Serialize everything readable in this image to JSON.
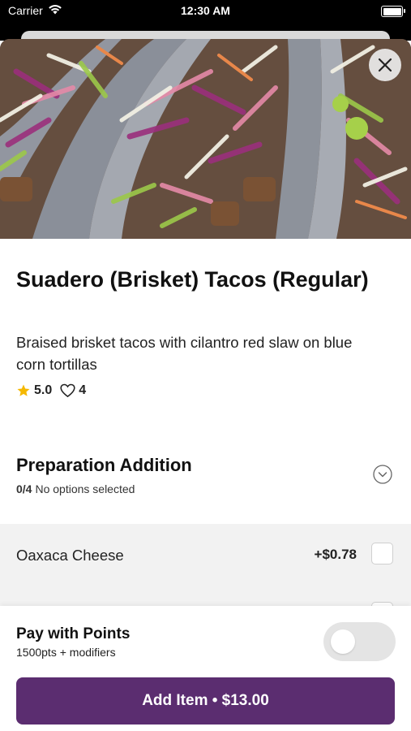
{
  "status_bar": {
    "carrier": "Carrier",
    "time": "12:30 AM"
  },
  "item": {
    "title": "Suadero (Brisket) Tacos (Regular)",
    "description": "Braised brisket tacos with cilantro red slaw on blue corn tortillas",
    "rating": "5.0",
    "likes": "4"
  },
  "section": {
    "title": "Preparation Addition",
    "count": "0/4",
    "status": "No options selected"
  },
  "options": [
    {
      "label": "Oaxaca Cheese",
      "price": "+$0.78",
      "checked": false
    }
  ],
  "footer": {
    "points_title": "Pay with Points",
    "points_subtitle": "1500pts + modifiers",
    "points_enabled": false,
    "add_button": "Add Item • $13.00"
  },
  "colors": {
    "accent": "#5b2d70",
    "star": "#f5b800",
    "toggle_off": "#e4e4e4",
    "option_bg": "#f2f2f2"
  },
  "icons": [
    "wifi-icon",
    "battery-icon",
    "close-icon",
    "star-icon",
    "heart-icon",
    "chevron-down-icon"
  ]
}
